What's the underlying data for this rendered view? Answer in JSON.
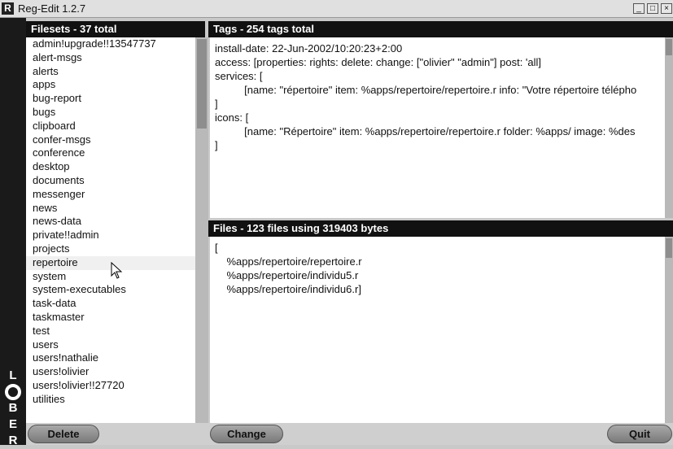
{
  "window": {
    "title": "Reg-Edit 1.2.7",
    "app_icon_letter": "R",
    "controls": {
      "minimize": "_",
      "maximize": "□",
      "close": "×"
    }
  },
  "sidebar_logo": {
    "letters": [
      "R",
      "E",
      "B",
      "O",
      "L"
    ]
  },
  "filesets": {
    "header": "Filesets - 37 total",
    "items": [
      "admin!upgrade!!13547737",
      "alert-msgs",
      "alerts",
      "apps",
      "bug-report",
      "bugs",
      "clipboard",
      "confer-msgs",
      "conference",
      "desktop",
      "documents",
      "messenger",
      "news",
      "news-data",
      "private!!admin",
      "projects",
      "repertoire",
      "system",
      "system-executables",
      "task-data",
      "taskmaster",
      "test",
      "users",
      "users!nathalie",
      "users!olivier",
      "users!olivier!!27720",
      "utilities"
    ]
  },
  "tags": {
    "header": "Tags - 254 tags total",
    "lines": [
      "install-date: 22-Jun-2002/10:20:23+2:00",
      "access: [properties: rights: delete: change: [\"olivier\" \"admin\"] post: 'all]",
      "services: [",
      "          [name: \"répertoire\" item: %apps/repertoire/repertoire.r info: \"Votre répertoire télépho",
      "]",
      "icons: [",
      "          [name: \"Répertoire\" item: %apps/repertoire/repertoire.r folder: %apps/ image: %des",
      "]"
    ]
  },
  "files": {
    "header": "Files - 123 files using 319403 bytes",
    "lines": [
      "[",
      "    %apps/repertoire/repertoire.r",
      "    %apps/repertoire/individu5.r",
      "    %apps/repertoire/individu6.r]"
    ]
  },
  "buttons": {
    "delete": "Delete",
    "change": "Change",
    "quit": "Quit"
  }
}
